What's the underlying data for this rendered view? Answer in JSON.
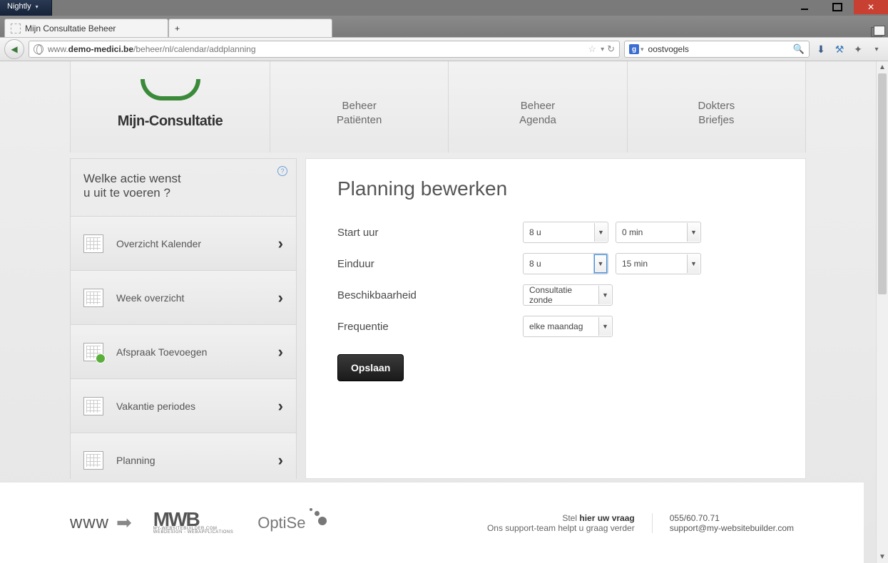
{
  "window": {
    "app_menu": "Nightly",
    "tab_title": "Mijn Consultatie Beheer",
    "url_prefix": "www.",
    "url_bold": "demo-medici.be",
    "url_rest": "/beheer/nl/calendar/addplanning",
    "search_value": "oostvogels"
  },
  "brand": {
    "name": "Mijn-Consultatie"
  },
  "topnav": {
    "items": [
      {
        "line1": "Beheer",
        "line2": "Patiënten"
      },
      {
        "line1": "Beheer",
        "line2": "Agenda"
      },
      {
        "line1": "Dokters",
        "line2": "Briefjes"
      }
    ]
  },
  "sidebar": {
    "prompt_line1": "Welke actie wenst",
    "prompt_line2": "u uit te voeren ?",
    "items": [
      {
        "label": "Overzicht Kalender"
      },
      {
        "label": "Week overzicht"
      },
      {
        "label": "Afspraak Toevoegen"
      },
      {
        "label": "Vakantie periodes"
      },
      {
        "label": "Planning"
      }
    ]
  },
  "main": {
    "title": "Planning bewerken",
    "fields": {
      "start_label": "Start uur",
      "start_hour": "8 u",
      "start_min": "0 min",
      "end_label": "Einduur",
      "end_hour": "8 u",
      "end_min": "15 min",
      "avail_label": "Beschikbaarheid",
      "avail_value": "Consultatie zonde",
      "freq_label": "Frequentie",
      "freq_value": "elke maandag"
    },
    "save_label": "Opslaan"
  },
  "footer": {
    "www": "www",
    "mwb": "MWB",
    "mwb_sub1": "MY-WEBSITEBUILDER.COM",
    "mwb_sub2": "WEBDESIGN - WEBAPPLICATIONS",
    "optiseo": "OptiSe",
    "support_line1_a": "Stel ",
    "support_line1_b": "hier uw vraag",
    "support_line2": "Ons support-team helpt u graag verder",
    "phone": "055/60.70.71",
    "email": "support@my-websitebuilder.com"
  }
}
